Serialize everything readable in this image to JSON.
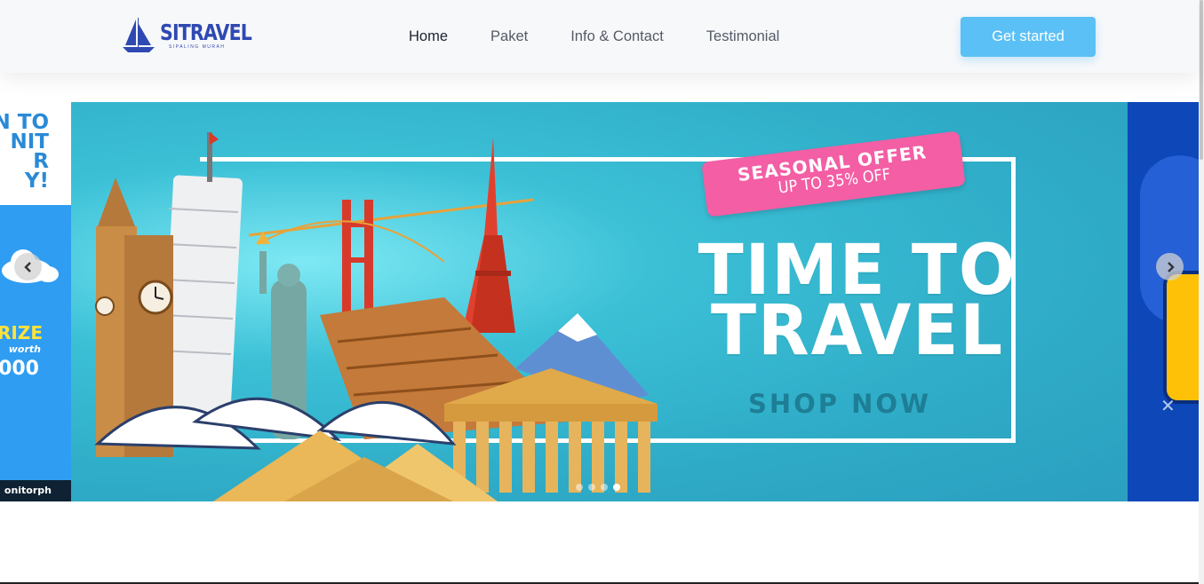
{
  "brand": {
    "name": "SITRAVEL",
    "tagline": "SIPALING MURAH"
  },
  "nav": {
    "items": [
      {
        "label": "Home",
        "active": true
      },
      {
        "label": "Paket",
        "active": false
      },
      {
        "label": "Info & Contact",
        "active": false
      },
      {
        "label": "Testimonial",
        "active": false
      }
    ],
    "cta_label": "Get started"
  },
  "carousel": {
    "prev_slide": {
      "headline": "N TO\nNIT\nR\nY!",
      "prize": "RIZE",
      "worth": "worth",
      "amount": "000",
      "footer": "onitorph"
    },
    "main_slide": {
      "badge_line1": "SEASONAL OFFER",
      "badge_line2": "UP TO 35% OFF",
      "headline_line1": "TIME TO",
      "headline_line2": "TRAVEL",
      "cta": "SHOP NOW"
    },
    "dots": {
      "count": 4,
      "active_index": 3
    },
    "prev_arrow_icon": "chevron-left-icon",
    "next_arrow_icon": "chevron-right-icon"
  },
  "colors": {
    "brand": "#2f49b2",
    "cta": "#5bc0f5",
    "slide_bg": "#2eaac6",
    "badge": "#f35ea4",
    "next_slide_bg": "#0d47b8"
  }
}
